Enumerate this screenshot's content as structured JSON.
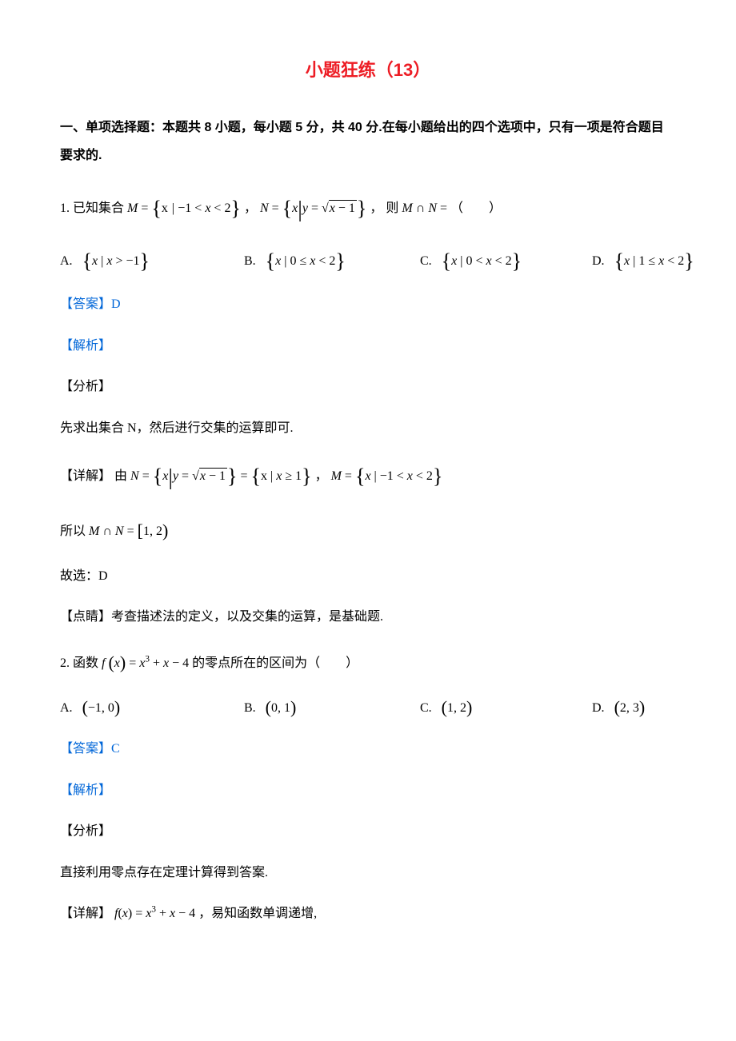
{
  "title": "小题狂练（13）",
  "section_header": "一、单项选择题：本题共 8 小题，每小题 5 分，共 40 分.在每小题给出的四个选项中，只有一项是符合题目要求的.",
  "q1": {
    "stem_pre": "1. 已知集合 ",
    "M_lhs": "M",
    "M_eq": " = ",
    "M_body": "x | −1 < x < 2",
    "stem_mid": "， ",
    "N_lhs": "N",
    "N_eq": " = ",
    "N_var": "x",
    "N_sep": " | ",
    "N_y": "y",
    "N_yeq": " = ",
    "N_sqrt_arg": "x − 1",
    "stem_post": "，  则 ",
    "MN": "M ∩ N",
    "eq_post": " = （　　）",
    "opt": {
      "a_label": "A.",
      "a_body": "x | x > −1",
      "b_label": "B.",
      "b_body": "x | 0 ≤ x < 2",
      "c_label": "C.",
      "c_body": "x | 0 < x < 2",
      "d_label": "D.",
      "d_body": "x | 1 ≤ x < 2"
    },
    "answer_label": "【答案】",
    "answer_val": "D",
    "jiexi": "【解析】",
    "fenxi_label": "【分析】",
    "fenxi_text": "先求出集合 N，然后进行交集的运算即可.",
    "detail_label": "【详解】",
    "detail_pre": "由 ",
    "detail_N": "N",
    "detail_Neq": " = ",
    "detail_Nvar": "x",
    "detail_Nsep": " | ",
    "detail_Ny": "y",
    "detail_Nyeq": " = ",
    "detail_Nsqrt": "x − 1",
    "detail_Nset2_pre": " = ",
    "detail_Nset2_body": "x | x ≥ 1",
    "detail_mid": "， ",
    "detail_M": "M",
    "detail_Meq": " = ",
    "detail_Mbody": "x | −1 < x < 2",
    "so_pre": "所以 ",
    "so_MN": "M ∩ N",
    "so_eq": " = ",
    "so_interval": "[1, 2)",
    "guxuan": "故选：D",
    "dianjing_label": "【点睛】",
    "dianjing_text": "考查描述法的定义，以及交集的运算，是基础题."
  },
  "q2": {
    "stem_pre": "2. 函数 ",
    "f": "f",
    "x_in_paren": "x",
    "eq": " = ",
    "poly": "x³ + x − 4",
    "stem_post": " 的零点所在的区间为（　　）",
    "opt": {
      "a_label": "A.",
      "a_body": "−1, 0",
      "b_label": "B.",
      "b_body": "0, 1",
      "c_label": "C.",
      "c_body": "1, 2",
      "d_label": "D.",
      "d_body": "2, 3"
    },
    "answer_label": "【答案】",
    "answer_val": "C",
    "jiexi": "【解析】",
    "fenxi_label": "【分析】",
    "fenxi_text": "直接利用零点存在定理计算得到答案.",
    "detail_label": "【详解】",
    "detail_f": "f",
    "detail_x": "x",
    "detail_eq": " = ",
    "detail_poly": "x³ + x − 4",
    "detail_post": " ，易知函数单调递增,"
  }
}
